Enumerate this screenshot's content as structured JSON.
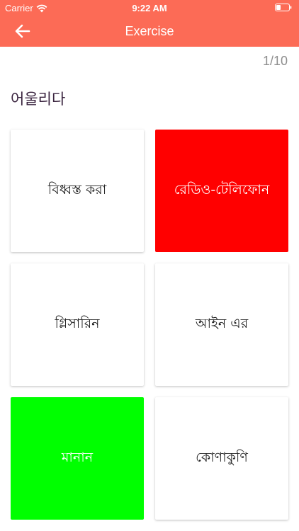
{
  "status_bar": {
    "carrier": "Carrier",
    "time": "9:22 AM"
  },
  "nav": {
    "title": "Exercise",
    "back_icon": "arrow-left-icon"
  },
  "progress": "1/10",
  "question": "어울리다",
  "options": [
    {
      "label": "বিধ্বস্ত করা",
      "state": "neutral"
    },
    {
      "label": "রেডিও-টেলিফোন",
      "state": "wrong"
    },
    {
      "label": "গ্লিসারিন",
      "state": "neutral"
    },
    {
      "label": "আইন এর",
      "state": "neutral"
    },
    {
      "label": "মানান",
      "state": "correct"
    },
    {
      "label": "কোণাকুণি",
      "state": "neutral"
    }
  ],
  "colors": {
    "header": "#fc6b56",
    "wrong": "#ff0000",
    "correct": "#00ff00",
    "progress_text": "#8e8e8e"
  }
}
